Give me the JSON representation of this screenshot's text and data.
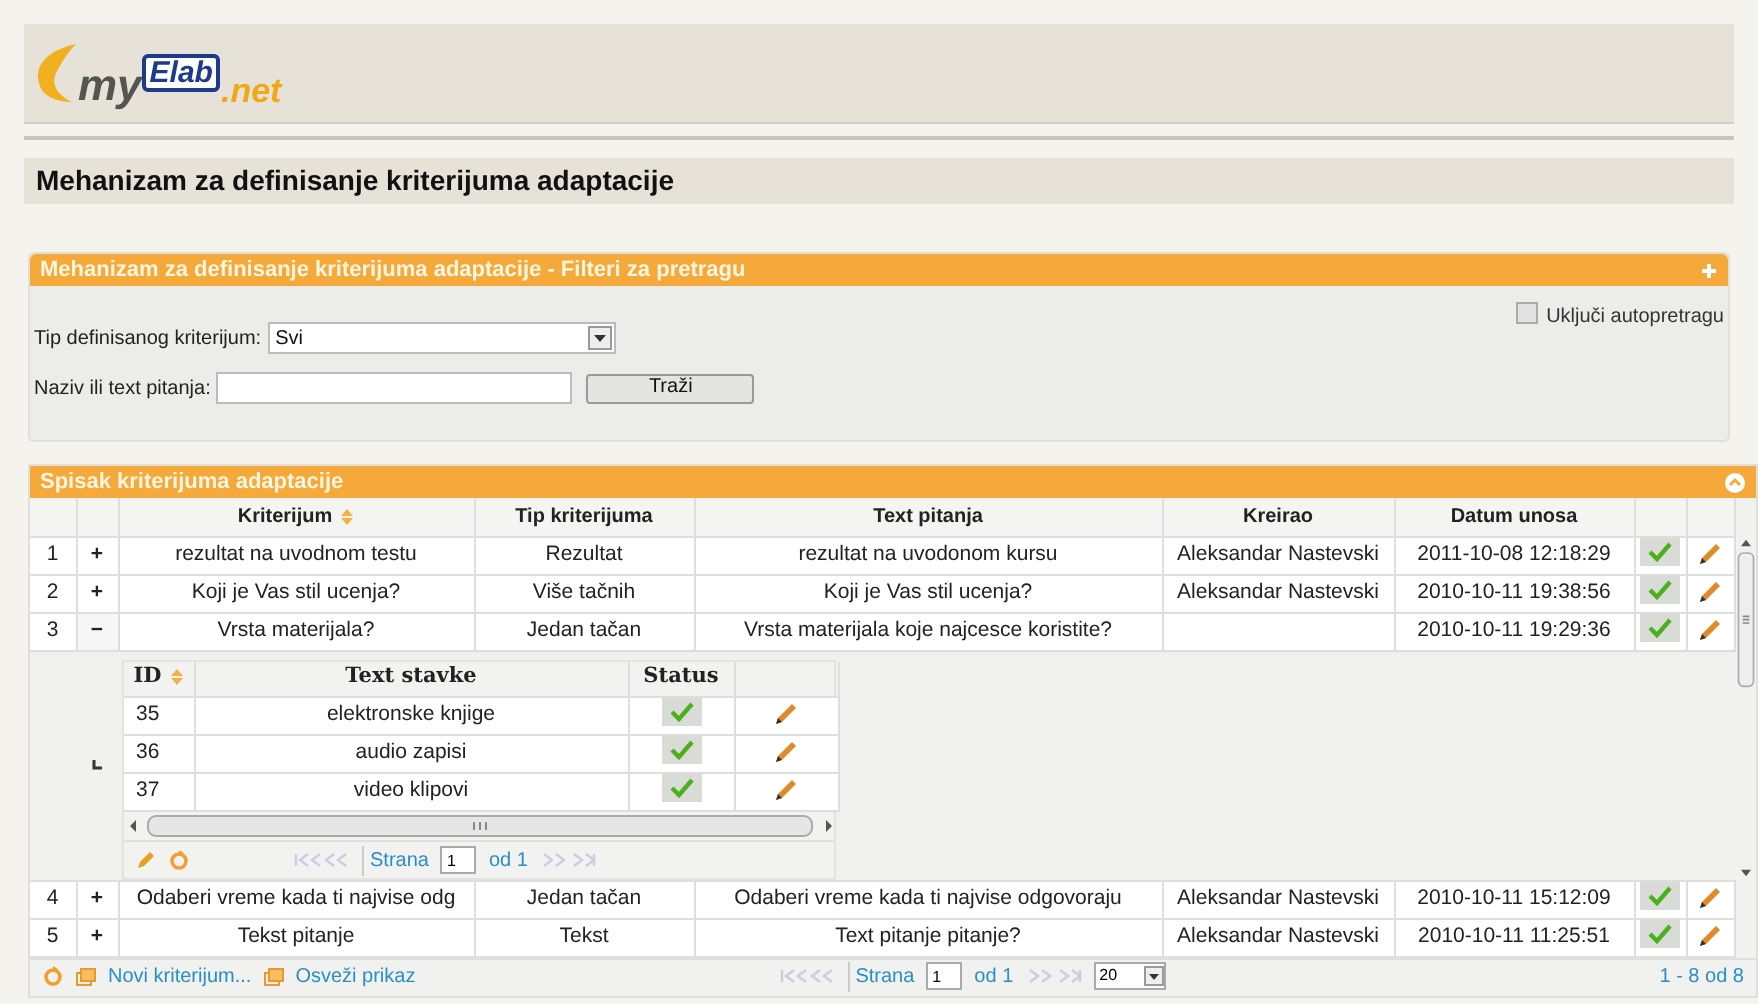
{
  "logo": {
    "my": "my",
    "elab": "Elab",
    "net": ".net"
  },
  "page_title": "Mehanizam za definisanje kriterijuma adaptacije",
  "filter_panel": {
    "title": "Mehanizam za definisanje kriterijuma adaptacije - Filteri za pretragu",
    "type_label": "Tip definisanog kriterijum:",
    "type_value": "Svi",
    "text_label": "Naziv ili text pitanja:",
    "search_button": "Traži",
    "auto_search": {
      "label": "Uključi autopretragu",
      "checked": false
    }
  },
  "grid": {
    "title": "Spisak kriterijuma adaptacije",
    "columns": [
      "Kriterijum",
      "Tip kriterijuma",
      "Text pitanja",
      "Kreirao",
      "Datum unosa"
    ],
    "rows": [
      {
        "number": "1",
        "toggle": "+",
        "expanded": false,
        "criterion": "rezultat na uvodnom testu",
        "type": "Rezultat",
        "question": "rezultat na uvodonom kursu",
        "author": "Aleksandar Nastevski",
        "date": "2011-10-08 12:18:29",
        "active": true
      },
      {
        "number": "2",
        "toggle": "+",
        "expanded": false,
        "criterion": "Koji je Vas stil ucenja?",
        "type": "Više tačnih",
        "question": "Koji je Vas stil ucenja?",
        "author": "Aleksandar Nastevski",
        "date": "2010-10-11 19:38:56",
        "active": true
      },
      {
        "number": "3",
        "toggle": "−",
        "expanded": true,
        "criterion": "Vrsta materijala?",
        "type": "Jedan tačan",
        "question": "Vrsta materijala koje najcesce koristite?",
        "author": "",
        "date": "2010-10-11 19:29:36",
        "active": true,
        "subgrid": {
          "columns": [
            "ID",
            "Text stavke",
            "Status"
          ],
          "items": [
            {
              "id": "35",
              "text": "elektronske knjige",
              "active": true
            },
            {
              "id": "36",
              "text": "audio zapisi",
              "active": true
            },
            {
              "id": "37",
              "text": "video klipovi",
              "active": true
            }
          ],
          "pager": {
            "page_label": "Strana",
            "page": "1",
            "of": "od 1"
          }
        }
      },
      {
        "number": "4",
        "toggle": "+",
        "expanded": false,
        "criterion": "Odaberi vreme kada ti najvise odg",
        "type": "Jedan tačan",
        "question": "Odaberi vreme kada ti najvise odgovoraju",
        "author": "Aleksandar Nastevski",
        "date": "2010-10-11 15:12:09",
        "active": true
      },
      {
        "number": "5",
        "toggle": "+",
        "expanded": false,
        "criterion": "Tekst pitanje",
        "type": "Tekst",
        "question": "Text pitanje pitanje?",
        "author": "Aleksandar Nastevski",
        "date": "2010-10-11 11:25:51",
        "active": true
      }
    ],
    "footer": {
      "new_link": "Novi kriterijum...",
      "refresh_link": "Osveži prikaz",
      "page_label": "Strana",
      "page": "1",
      "of": "od 1",
      "page_size": "20",
      "summary": "1 - 8 od 8"
    }
  }
}
